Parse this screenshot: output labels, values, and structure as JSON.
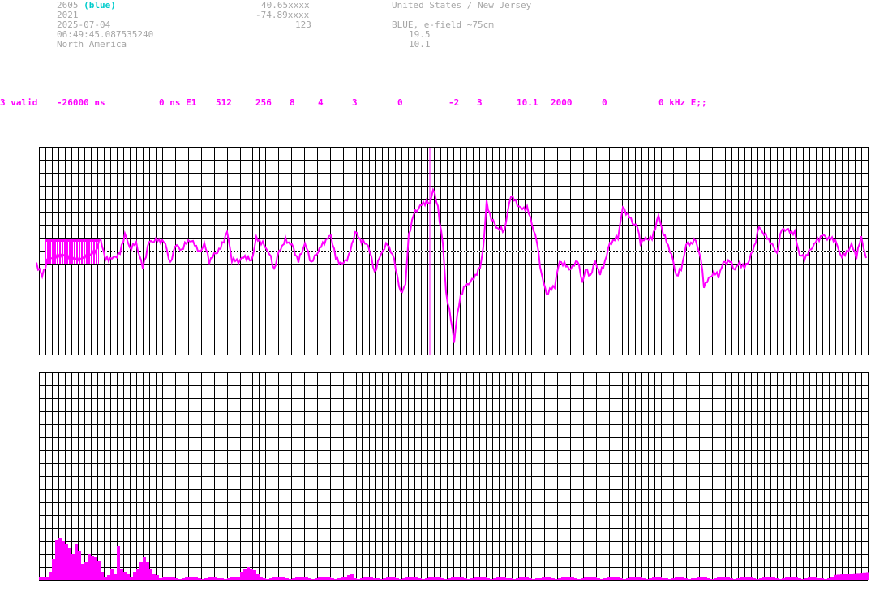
{
  "info": {
    "station_id": "2605",
    "station_color_label": "(blue)",
    "year": "2021",
    "date": "2025-07-04",
    "time": "06:49:45.087535240",
    "continent": "North America",
    "latitude": "40.65xxxx",
    "longitude": "-74.89xxxx",
    "altitude": "123",
    "location": "United States / New Jersey",
    "antenna": "BLUE, e-field ~75cm",
    "value_a": "19.5",
    "value_b": "10.1"
  },
  "status_fields": [
    "3 valid",
    "-26000 ns",
    "0 ns E1",
    "512",
    "256",
    "8",
    "4",
    "3",
    "0",
    "-2",
    "3",
    "10.1",
    "2000",
    "0",
    "0 kHz E;;"
  ],
  "colors": {
    "signal": "#ff00ff",
    "accent": "#00cccc",
    "text_gray": "#a6a6a6",
    "grid": "#000000"
  }
}
